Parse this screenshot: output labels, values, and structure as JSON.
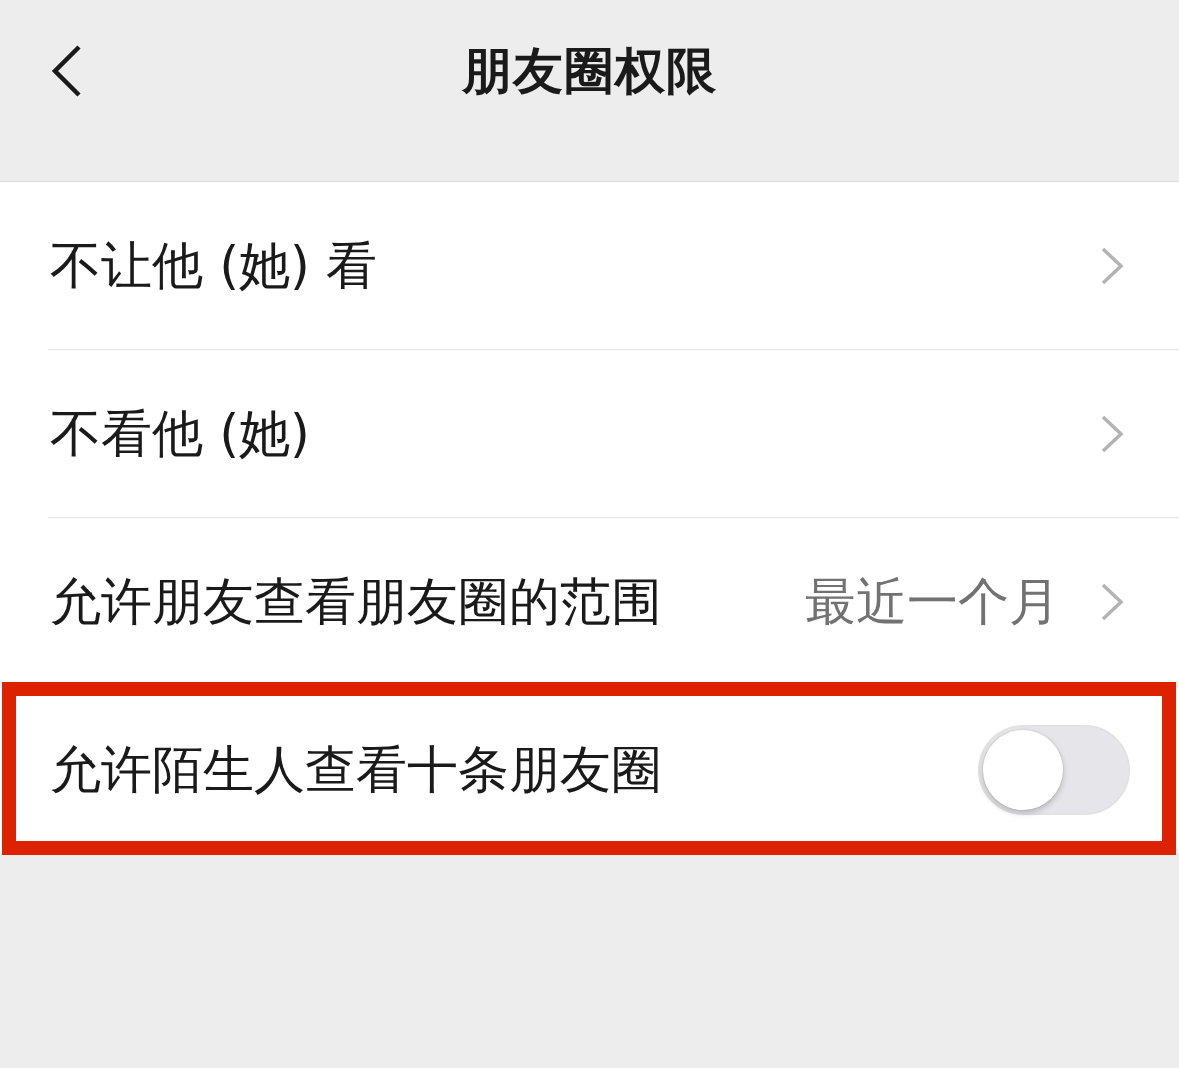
{
  "header": {
    "title": "朋友圈权限"
  },
  "items": [
    {
      "kind": "link",
      "label": "不让他 (她) 看",
      "highlighted": false
    },
    {
      "kind": "link",
      "label": "不看他 (她)",
      "highlighted": false
    },
    {
      "kind": "link",
      "label": "允许朋友查看朋友圈的范围",
      "value": "最近一个月",
      "highlighted": false
    },
    {
      "kind": "toggle",
      "label": "允许陌生人查看十条朋友圈",
      "on": false,
      "highlighted": true
    }
  ]
}
